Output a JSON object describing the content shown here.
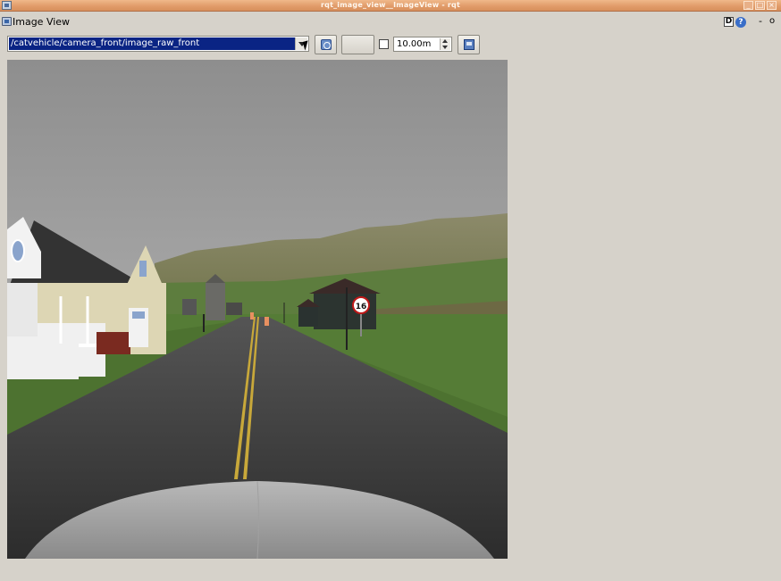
{
  "window": {
    "title": "rqt_image_view__ImageView - rqt",
    "controls": {
      "minimize": "_",
      "maximize": "□",
      "close": "×"
    }
  },
  "plugin": {
    "title": "Image View",
    "dock_button": "D",
    "help_button": "?",
    "min_button": "-",
    "close_button": "o"
  },
  "toolbar": {
    "topic": "/catvehicle/camera_front/image_raw_front",
    "zoom_checkbox_checked": false,
    "zoom_value": "10.00m"
  },
  "image": {
    "sign_text": "16"
  },
  "icons": {
    "app": "app-window-icon",
    "plugin": "image-view-icon",
    "refresh": "refresh-topics-icon",
    "save": "save-image-icon"
  }
}
